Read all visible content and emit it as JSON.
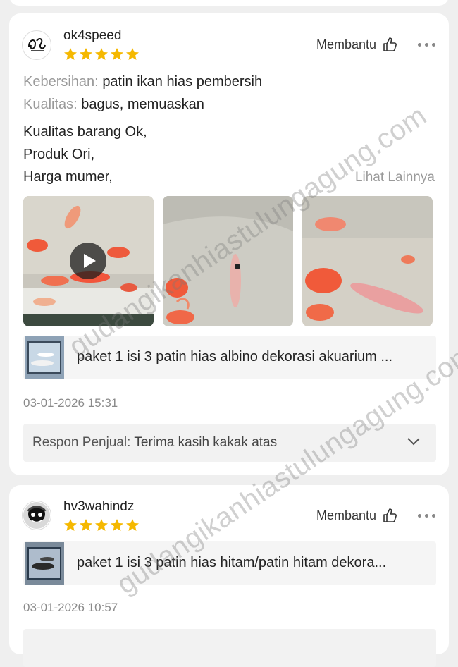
{
  "reviews": [
    {
      "username": "ok4speed",
      "rating": 5,
      "helpful_label": "Membantu",
      "attributes": [
        {
          "key": "Kebersihan:",
          "value": "patin ikan hias pembersih"
        },
        {
          "key": "Kualitas:",
          "value": "bagus, memuaskan"
        }
      ],
      "body_lines": [
        "Kualitas barang Ok,",
        "Produk Ori,",
        "Harga mumer,"
      ],
      "see_more": "Lihat Lainnya",
      "product_name": "paket 1 isi 3 patin hias albino dekorasi akuarium ...",
      "date": "03-01-2026 15:31",
      "response_label": "Respon Penjual:",
      "response_text": "Terima kasih kakak atas"
    },
    {
      "username": "hv3wahindz",
      "rating": 5,
      "helpful_label": "Membantu",
      "product_name": "paket 1 isi 3 patin hias hitam/patin hitam dekora...",
      "date": "03-01-2026 10:57"
    }
  ],
  "watermark": "gudangikanhiastulungagung.com",
  "colors": {
    "star": "#f5b800",
    "muted": "#9a9a9a"
  }
}
